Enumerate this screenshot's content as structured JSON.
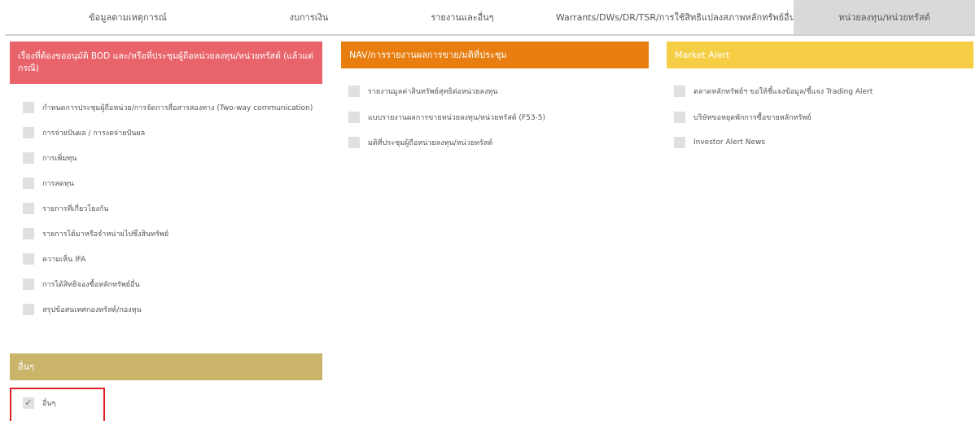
{
  "tabs": [
    {
      "label": "ข้อมูลตามเหตุการณ์"
    },
    {
      "label": "งบการเงิน"
    },
    {
      "label": "รายงานและอื่นๆ"
    },
    {
      "label": "Warrants/DWs/DR/TSR/การใช้สิทธิแปลงสภาพหลักทรัพย์อื่น"
    },
    {
      "label": "หน่วยลงทุน/หน่วยทรัสต์"
    }
  ],
  "panels": {
    "bod": {
      "title": "เรื่องที่ต้องขออนุมัติ BOD และ/หรือที่ประชุมผู้ถือหน่วยลงทุน/หน่วยทรัสต์ (แล้วแต่กรณี)",
      "color": "#e8646a",
      "items": [
        "กำหนดการประชุมผู้ถือหน่วย/การจัดการสื่อสารสองทาง (Two-way communication)",
        "การจ่ายปันผล / การงดจ่ายปันผล",
        "การเพิ่มทุน",
        "การลดทุน",
        "รายการที่เกี่ยวโยงกัน",
        "รายการได้มาหรือจำหน่ายไปซึ่งสินทรัพย์",
        "ความเห็น IFA",
        "การได้สิทธิจองซื้อหลักทรัพย์อื่น",
        "สรุปข้อสนเทศกองทรัสต์/กองทุน"
      ]
    },
    "nav": {
      "title": "NAV/การรายงานผลการขาย/มติที่ประชุม",
      "color": "#e87d10",
      "items": [
        "รายงานมูลค่าสินทรัพย์สุทธิต่อหน่วยลงทุน",
        "แบบรายงานผลการขายหน่วยลงทุน/หน่วยทรัสต์ (F53-5)",
        "มติที่ประชุมผู้ถือหน่วยลงทุน/หน่วยทรัสต์"
      ]
    },
    "alert": {
      "title": "Market Alert",
      "color": "#f5ce45",
      "items": [
        "ตลาดหลักทรัพย์ฯ ขอให้ชี้แจงข้อมูล/ชี้แจง Trading Alert",
        "บริษัทขอหยุดพักการซื้อขายหลักทรัพย์",
        "Investor Alert News"
      ]
    },
    "other": {
      "title": "อื่นๆ",
      "color": "#c9b46a",
      "items": [
        {
          "label": "อื่นๆ",
          "checked": true,
          "check_glyph": "✓"
        }
      ]
    }
  }
}
